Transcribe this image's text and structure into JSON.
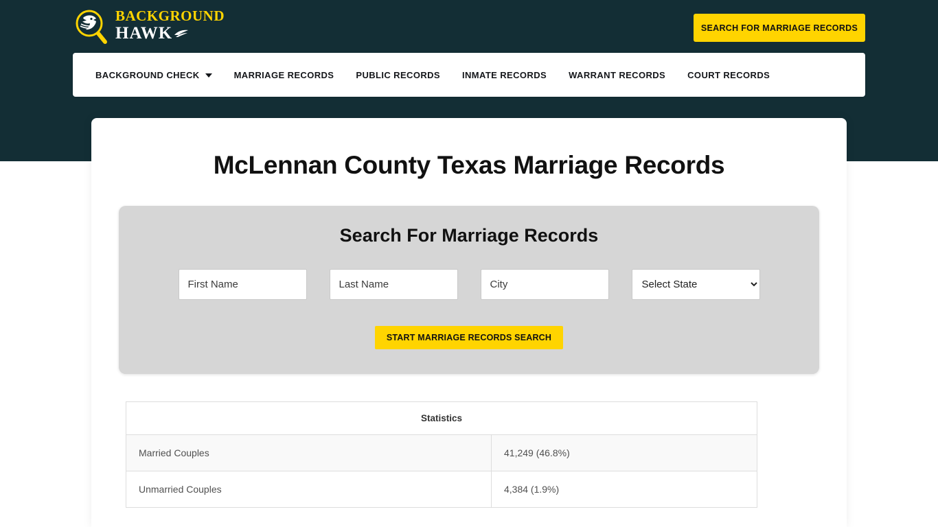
{
  "brand": {
    "logo_line1": "BACKGROUND",
    "logo_line2": "HAWK",
    "accent_color": "#FFD400",
    "header_bg": "#132E35"
  },
  "header": {
    "cta_label": "SEARCH FOR MARRIAGE RECORDS"
  },
  "nav": {
    "items": [
      {
        "label": "BACKGROUND CHECK",
        "has_dropdown": true
      },
      {
        "label": "MARRIAGE RECORDS",
        "has_dropdown": false
      },
      {
        "label": "PUBLIC RECORDS",
        "has_dropdown": false
      },
      {
        "label": "INMATE RECORDS",
        "has_dropdown": false
      },
      {
        "label": "WARRANT RECORDS",
        "has_dropdown": false
      },
      {
        "label": "COURT RECORDS",
        "has_dropdown": false
      }
    ]
  },
  "main": {
    "page_title": "McLennan County Texas Marriage Records",
    "search_panel": {
      "title": "Search For Marriage Records",
      "first_name_placeholder": "First Name",
      "first_name_value": "",
      "last_name_placeholder": "Last Name",
      "last_name_value": "",
      "city_placeholder": "City",
      "city_value": "",
      "state_selected": "Select State",
      "submit_label": "START MARRIAGE RECORDS SEARCH"
    },
    "stats_table": {
      "header": "Statistics",
      "rows": [
        {
          "label": "Married Couples",
          "value": "41,249 (46.8%)"
        },
        {
          "label": "Unmarried Couples",
          "value": "4,384 (1.9%)"
        }
      ]
    }
  }
}
